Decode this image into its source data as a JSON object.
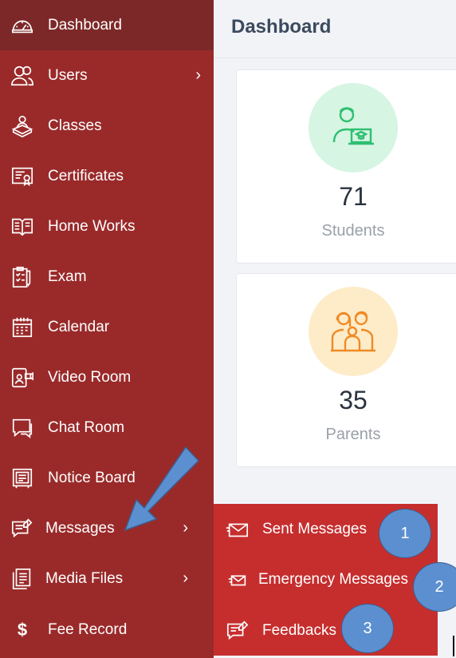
{
  "sidebar": {
    "items": [
      {
        "label": "Dashboard",
        "icon": "dashboard-gauge-icon",
        "active": true,
        "chevron": ""
      },
      {
        "label": "Users",
        "icon": "users-icon",
        "chevron": "›"
      },
      {
        "label": "Classes",
        "icon": "classes-icon",
        "chevron": ""
      },
      {
        "label": "Certificates",
        "icon": "certificate-icon",
        "chevron": ""
      },
      {
        "label": "Home Works",
        "icon": "book-icon",
        "chevron": ""
      },
      {
        "label": "Exam",
        "icon": "exam-clipboard-icon",
        "chevron": ""
      },
      {
        "label": "Calendar",
        "icon": "calendar-icon",
        "chevron": ""
      },
      {
        "label": "Video Room",
        "icon": "video-room-icon",
        "chevron": ""
      },
      {
        "label": "Chat Room",
        "icon": "chat-icon",
        "chevron": ""
      },
      {
        "label": "Notice Board",
        "icon": "notice-board-icon",
        "chevron": ""
      },
      {
        "label": "Messages",
        "icon": "messages-icon",
        "chevron": "›"
      },
      {
        "label": "Media Files",
        "icon": "media-files-icon",
        "chevron": "›"
      },
      {
        "label": "Fee Record",
        "icon": "dollar-icon",
        "glyph": "$",
        "chevron": ""
      }
    ]
  },
  "header": {
    "title": "Dashboard"
  },
  "stats": [
    {
      "value": "71",
      "label": "Students",
      "icon": "student-icon",
      "circle_color": "#d6f5e3",
      "icon_color": "#2fbf71"
    },
    {
      "value": "35",
      "label": "Parents",
      "icon": "parents-icon",
      "circle_color": "#feecc9",
      "icon_color": "#f08a24"
    }
  ],
  "messages_submenu": {
    "items": [
      {
        "label": "Sent Messages",
        "icon": "envelope-icon"
      },
      {
        "label": "Emergency Messages",
        "icon": "envelope-small-icon"
      },
      {
        "label": "Feedbacks",
        "icon": "feedback-icon"
      }
    ]
  },
  "annotations": {
    "badges": [
      "1",
      "2",
      "3"
    ],
    "arrow_color": "#5b8fd0"
  },
  "colors": {
    "sidebar": "#9a2a2a",
    "sidebar_active": "#7d2828",
    "submenu": "#c62e2e",
    "badge": "#5b8fd0"
  }
}
